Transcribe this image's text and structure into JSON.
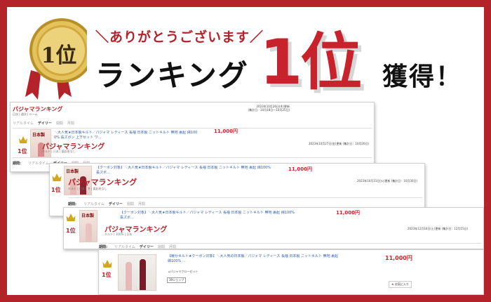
{
  "banner": {
    "medal_label": "1位",
    "thanks": "＼ありがとうございます／",
    "ranking": "ランキング",
    "rank": "1位",
    "acquired": "獲得！"
  },
  "colors": {
    "background": "#b5232a",
    "rank_red": "#c8232c",
    "link_blue": "#2a5db0",
    "gold": "#c9a032"
  },
  "list_header": {
    "title": "パジャマランキング",
    "date_line1": "2023年10月26日(木)更新",
    "date_line2": "(集計日：10月18日〜10月25日)",
    "sub": "日次 | 週次 | ルーム"
  },
  "cards": [
    {
      "tabs": [
        "リアルタイム",
        "デイリー",
        "週間",
        "月間"
      ],
      "period_label": "期間:",
      "rank": "1位",
      "thumb_mark": "日本製",
      "desc_line1": "＼大人気★日本製キルト／パジャマ レディース 長袖 日本製 ニットキルト 無地 裏起 綿100",
      "desc_line2": "0% 長ズボン 上下セット ワ…",
      "price": "11,000円",
      "shop": "パジャマランキング",
      "tags": "キルト | 日本 | 裏起毛なし",
      "updated": "2023年10月27日(金)更新 (集計日：10月26日)"
    },
    {
      "tabs": [
        "リアルタイム",
        "デイリー",
        "週間",
        "月間"
      ],
      "period_label": "期間:",
      "rank": "1位",
      "thumb_mark": "日本製",
      "desc_line1": "【クーポン対象】＼大人気★日本製キルト／パジャマ レディース 長袖 日本製 ニットキルト 無地 裏起 綿100%",
      "desc_line2": "長ズボ…",
      "price": "11,000円",
      "shop": "パジャマランキング",
      "tags": "キルト | 日本 | 冬 | 裏起毛なし",
      "updated": "2023年10月31日(火)更新 (集計日：10月30日)"
    },
    {
      "tabs": [
        "リアルタイム",
        "デイリー",
        "週間",
        "月間"
      ],
      "period_label": "期間:",
      "rank": "1位",
      "thumb_mark": "日本製",
      "desc_line1": "【クーポン対象】＼大人気★日本製キルト／パジャマ レディース 長袖 日本製 ニットキルト 無地 裏起 綿100%",
      "desc_line2": "長ズボ…",
      "price": "11,000円",
      "shop": "パジャマランキング",
      "tags": "キルト | 100% | 日本",
      "updated": "2023年12月16日(土)更新 (集計日：12月15日)"
    },
    {
      "tabs": [
        "リアルタイム",
        "デイリー",
        "週間",
        "月間"
      ],
      "period_label": "期間:",
      "rank": "1位",
      "desc_line1": "【暖かキルト★クーポン対象】＼大人気の日本製／パジャマ レディース 長袖 日本製 ニットキルト 無地 裏起",
      "desc_line2": "綿100% …",
      "price": "11,000円",
      "shop_link": "パジャマクローゼット",
      "badge": "39ショップ",
      "fav": "お気に入り"
    }
  ]
}
